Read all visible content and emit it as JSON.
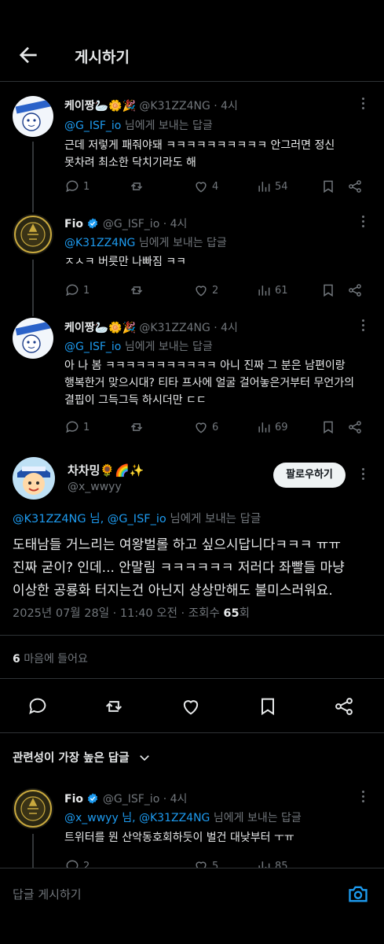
{
  "header": {
    "title": "게시하기"
  },
  "replies": [
    {
      "name": "케이짱",
      "name_emoji": "🦢🌼🎉",
      "handle": "@K31ZZ4NG",
      "time": "· 4시",
      "reply_to_prefix": "",
      "reply_to_mentions": "@G_ISF_io",
      "reply_to_suffix": " 님에게 보내는 답글",
      "text_lines": [
        "근데 저렇게 패줘야돼 ㅋㅋㅋㅋㅋㅋㅋㅋㅋㅋ 안그러면 정신",
        "못차려 최소한 닥치기라도 해"
      ],
      "replies": "1",
      "retweets": "",
      "likes": "4",
      "views": "54"
    },
    {
      "name": "Fio",
      "verified": true,
      "handle": "@G_ISF_io",
      "time": "· 4시",
      "reply_to_mentions": "@K31ZZ4NG",
      "reply_to_suffix": " 님에게 보내는 답글",
      "text_lines": [
        "ㅈㅅㅋ 버릇만 나빠짐 ㅋㅋ"
      ],
      "replies": "1",
      "retweets": "",
      "likes": "2",
      "views": "61"
    },
    {
      "name": "케이짱",
      "name_emoji": "🦢🌼🎉",
      "handle": "@K31ZZ4NG",
      "time": "· 4시",
      "reply_to_mentions": "@G_ISF_io",
      "reply_to_suffix": " 님에게 보내는 답글",
      "text_lines": [
        "아 나 봄 ㅋㅋㅋㅋㅋㅋㅋㅋㅋㅋㅋ 아니 진짜 그 분은 남편이랑",
        "행복한거 맞으시대? 티타 프사에 얼굴 걸어놓은거부터 무언가의",
        "결핍이 그득그득 하시더만 ㄷㄷ"
      ],
      "replies": "1",
      "retweets": "",
      "likes": "6",
      "views": "69"
    }
  ],
  "main_post": {
    "name": "차차밍",
    "name_emoji": "🌻🌈✨",
    "handle": "@x_wwyy",
    "follow_label": "팔로우하기",
    "reply_to_mentions": "@K31ZZ4NG 님, @G_ISF_io",
    "reply_to_suffix": " 님에게 보내는 답글",
    "text_lines": [
      "도태남들 거느리는 여왕벌롤 하고 싶으시답니다ㅋㅋㅋ ㅠㅠ",
      "진짜 굳이? 인데... 안말림 ㅋㅋㅋㅋㅋㅋ 저러다 좌빨들 마냥",
      "이상한 공룡화 터지는건 아닌지 상상만해도 불미스러워요."
    ],
    "timestamp": "2025년 07월 28일 · 11:40 오전 · 조회수",
    "views_count": "65",
    "views_suffix": "회",
    "likes_count": "6",
    "likes_label": " 마음에 들어요"
  },
  "sort": {
    "label": "관련성이 가장 높은 답글"
  },
  "bottom_reply": {
    "name": "Fio",
    "handle": "@G_ISF_io",
    "time": "· 4시",
    "reply_to_mentions": "@x_wwyy 님, @K31ZZ4NG",
    "reply_to_suffix": " 님에게 보내는 답글",
    "text": "트위터를 뭔 산악동호회하듯이 벌건 대낮부터 ㅜㅠ",
    "replies": "2",
    "likes": "5",
    "views": "85"
  },
  "composer": {
    "placeholder": "답글 게시하기"
  },
  "colors": {
    "accent": "#1d9bf0",
    "muted": "#71767b",
    "text": "#e7e9ea"
  }
}
